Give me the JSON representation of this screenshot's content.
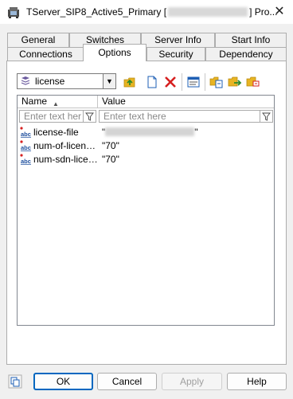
{
  "window": {
    "title_prefix": "TServer_SIP8_Active5_Primary [",
    "title_suffix": "] Pro...",
    "close_glyph": "✕"
  },
  "tabs": {
    "row_back": [
      {
        "label": "General"
      },
      {
        "label": "Switches"
      },
      {
        "label": "Server Info"
      },
      {
        "label": "Start Info"
      }
    ],
    "row_front": [
      {
        "label": "Connections"
      },
      {
        "label": "Options"
      },
      {
        "label": "Security"
      },
      {
        "label": "Dependency"
      }
    ],
    "active": "Options"
  },
  "toolbar": {
    "section_selected": "license",
    "icons": [
      "up-folder-icon",
      "new-document-icon",
      "delete-icon",
      "properties-icon",
      "copy-icon",
      "export-icon",
      "import-icon"
    ]
  },
  "grid": {
    "columns": [
      {
        "label": "Name"
      },
      {
        "label": "Value"
      }
    ],
    "filter_placeholder_name": "Enter text here",
    "filter_placeholder_value": "Enter text here",
    "rows": [
      {
        "name": "license-file",
        "value_open": "\"",
        "value_close": "\"",
        "value": ""
      },
      {
        "name": "num-of-licenses",
        "value": "\"70\""
      },
      {
        "name": "num-sdn-licen...",
        "value": "\"70\""
      }
    ]
  },
  "buttons": {
    "ok": "OK",
    "cancel": "Cancel",
    "apply": "Apply",
    "help": "Help"
  },
  "colors": {
    "accent": "#0067c0",
    "icon_red": "#d62020",
    "icon_blue": "#1e5fb4",
    "icon_yellow": "#e8b423"
  }
}
